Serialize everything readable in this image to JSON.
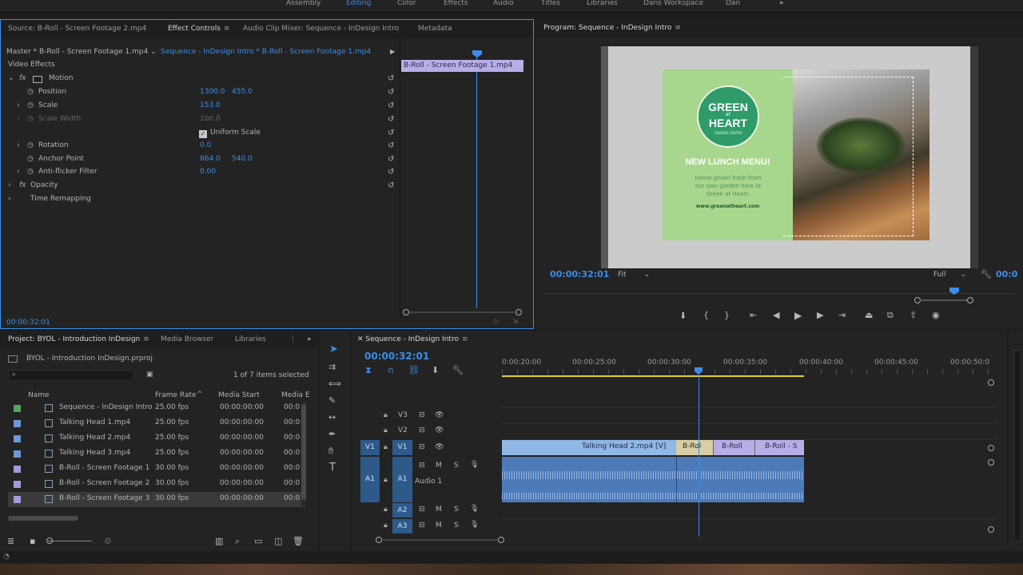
{
  "workspaces": [
    "Assembly",
    "Editing",
    "Color",
    "Effects",
    "Audio",
    "Titles",
    "Libraries",
    "Dans Workspace",
    "Dan"
  ],
  "active_workspace": "Editing",
  "more_glyph": "»",
  "source_panel": {
    "tabs": [
      "Source: B-Roll - Screen Footage 2.mp4",
      "Effect Controls",
      "Audio Clip Mixer: Sequence - InDesign Intro",
      "Metadata"
    ],
    "master_label": "Master * B-Roll - Screen Footage 1.mp4",
    "sequence_label": "Sequence - InDesign Intro * B-Roll - Screen Footage 1.mp4",
    "clip_label": "B-Roll - Screen Footage 1.mp4",
    "section": "Video Effects",
    "effects": {
      "motion": "Motion",
      "position": "Position",
      "position_x": "1300.0",
      "position_y": "455.0",
      "scale": "Scale",
      "scale_v": "153.0",
      "scale_width": "Scale Width",
      "scale_width_v": "100.0",
      "uniform_scale": "Uniform Scale",
      "rotation": "Rotation",
      "rotation_v": "0.0",
      "anchor": "Anchor Point",
      "anchor_x": "864.0",
      "anchor_y": "540.0",
      "antiflicker": "Anti-flicker Filter",
      "antiflicker_v": "0.00",
      "opacity": "Opacity",
      "time_remap": "Time Remapping"
    },
    "timecode": "00:00:32:01"
  },
  "program": {
    "title": "Program: Sequence - InDesign Intro",
    "timecode": "00:00:32:01",
    "fit": "Fit",
    "quality": "Full",
    "right_timecode": "00:0",
    "card": {
      "logo_line1": "GREEN",
      "logo_line2": "HEART",
      "logo_small": "at",
      "logo_sub": "GARDEN CENTRE",
      "headline": "NEW LUNCH MENU!",
      "body": "Home grown fresh from our own garden here at Green at Heart.",
      "url": "www.greenatheart.com"
    }
  },
  "project": {
    "tabs": [
      "Project: BYOL - Introduction InDesign",
      "Media Browser",
      "Libraries"
    ],
    "file": "BYOL - Introduction InDesign.prproj",
    "selection": "1 of 7 items selected",
    "columns": [
      "Name",
      "Frame Rate",
      "Media Start",
      "Media E"
    ],
    "items": [
      {
        "name": "Sequence - InDesign Intro",
        "fps": "25.00 fps",
        "start": "00:00:00:00",
        "end": "00:0",
        "color": "#52a85a"
      },
      {
        "name": "Talking Head 1.mp4",
        "fps": "25.00 fps",
        "start": "00:00:00:00",
        "end": "00:0",
        "color": "#6b9ad6"
      },
      {
        "name": "Talking Head 2.mp4",
        "fps": "25.00 fps",
        "start": "00:00:00:00",
        "end": "00:0",
        "color": "#6b9ad6"
      },
      {
        "name": "Talking Head 3.mp4",
        "fps": "25.00 fps",
        "start": "00:00:00:00",
        "end": "00:0",
        "color": "#6b9ad6"
      },
      {
        "name": "B-Roll - Screen Footage 1",
        "fps": "30.00 fps",
        "start": "00:00:00:00",
        "end": "00:0",
        "color": "#a39bd9"
      },
      {
        "name": "B-Roll - Screen Footage 2",
        "fps": "30.00 fps",
        "start": "00:00:00:00",
        "end": "00:0",
        "color": "#a39bd9"
      },
      {
        "name": "B-Roll - Screen Footage 3",
        "fps": "30.00 fps",
        "start": "00:00:00:00",
        "end": "00:0",
        "color": "#a39bd9"
      }
    ]
  },
  "timeline": {
    "title": "Sequence - InDesign Intro",
    "timecode": "00:00:32:01",
    "ticks": [
      "0:00:20:00",
      "00:00:25:00",
      "00:00:30:00",
      "00:00:35:00",
      "00:00:40:00",
      "00:00:45:00",
      "00:00:50:0"
    ],
    "tracks": {
      "v3": "V3",
      "v2": "V2",
      "v1": "V1",
      "a1": "A1",
      "a2": "A2",
      "a3": "A3",
      "audio1": "Audio 1",
      "m": "M",
      "s": "S"
    },
    "clips": {
      "talking_head": "Talking Head 2.mp4 [V]",
      "broll_a": "B-Rol",
      "broll_b": "B-Roll",
      "broll_c": "B-Roll - S"
    }
  },
  "colors": {
    "accent": "#3c8ee8",
    "video_clip": "#8fb8e6",
    "broll_clip": "#b7aee6",
    "audio_clip": "#4d7ab8",
    "card_green": "#a8d68c"
  }
}
